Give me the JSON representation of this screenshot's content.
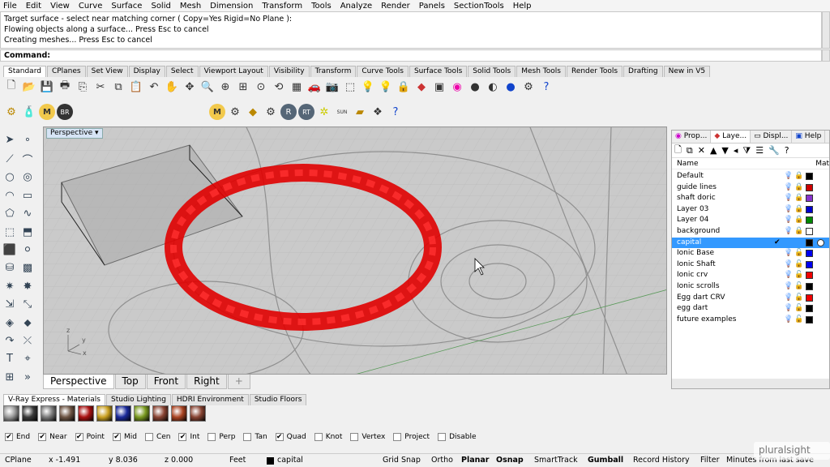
{
  "menu": [
    "File",
    "Edit",
    "View",
    "Curve",
    "Surface",
    "Solid",
    "Mesh",
    "Dimension",
    "Transform",
    "Tools",
    "Analyze",
    "Render",
    "Panels",
    "SectionTools",
    "Help"
  ],
  "history": [
    "Target surface - select near matching corner ( Copy=Yes  Rigid=No  Plane ):",
    "Flowing objects along a surface... Press Esc to cancel",
    "Creating meshes... Press Esc to cancel"
  ],
  "command_label": "Command:",
  "toolbar_tabs": [
    "Standard",
    "CPlanes",
    "Set View",
    "Display",
    "Select",
    "Viewport Layout",
    "Visibility",
    "Transform",
    "Curve Tools",
    "Surface Tools",
    "Solid Tools",
    "Mesh Tools",
    "Render Tools",
    "Drafting",
    "New in V5"
  ],
  "plugin_labels": {
    "m": "M",
    "br": "BR",
    "r": "R",
    "rt": "RT",
    "sun": "SUN"
  },
  "viewport": {
    "title": "Perspective",
    "axis_y": "y",
    "axis_z": "z",
    "axis_x": "x"
  },
  "viewport_tabs": [
    "Perspective",
    "Top",
    "Front",
    "Right"
  ],
  "viewport_add": "+",
  "panel": {
    "tabs": [
      "Prop...",
      "Laye...",
      "Displ...",
      "Help"
    ],
    "name_header": "Name",
    "mat_header": "Mat",
    "layers": [
      {
        "name": "Default",
        "color": "#000000",
        "locked": true
      },
      {
        "name": "guide lines",
        "color": "#cc0000",
        "locked": true
      },
      {
        "name": "shaft doric",
        "color": "#8833cc",
        "locked": true
      },
      {
        "name": "Layer 03",
        "color": "#0000cc",
        "locked": true
      },
      {
        "name": "Layer 04",
        "color": "#008800",
        "locked": true
      },
      {
        "name": "background",
        "color": "#ffffff",
        "locked": true
      },
      {
        "name": "capital",
        "color": "#000000",
        "locked": false,
        "selected": true
      },
      {
        "name": "Ionic Base",
        "color": "#0000ee",
        "locked": false
      },
      {
        "name": "Ionic Shaft",
        "color": "#0000ee",
        "locked": false
      },
      {
        "name": "Ionic crv",
        "color": "#ee0000",
        "locked": false
      },
      {
        "name": "Ionic scrolls",
        "color": "#000000",
        "locked": false
      },
      {
        "name": "Egg dart CRV",
        "color": "#ee0000",
        "locked": false
      },
      {
        "name": "egg dart",
        "color": "#000000",
        "locked": false
      },
      {
        "name": "future examples",
        "color": "#000000",
        "locked": false
      }
    ]
  },
  "lower_tabs": [
    "V-Ray Express - Materials",
    "Studio Lighting",
    "HDRI Environment",
    "Studio Floors"
  ],
  "materials": [
    "#9a9a9a",
    "#3a3a3a",
    "#7a7a7a",
    "#6e5544",
    "#aa1111",
    "#c9a020",
    "#1a2a9a",
    "#7a9a20",
    "#8a4433",
    "#aa4422",
    "#884433"
  ],
  "osnaps": [
    {
      "label": "End",
      "on": true
    },
    {
      "label": "Near",
      "on": true
    },
    {
      "label": "Point",
      "on": true
    },
    {
      "label": "Mid",
      "on": true
    },
    {
      "label": "Cen",
      "on": false
    },
    {
      "label": "Int",
      "on": true
    },
    {
      "label": "Perp",
      "on": false
    },
    {
      "label": "Tan",
      "on": false
    },
    {
      "label": "Quad",
      "on": true
    },
    {
      "label": "Knot",
      "on": false
    },
    {
      "label": "Vertex",
      "on": false
    },
    {
      "label": "Project",
      "on": false
    },
    {
      "label": "Disable",
      "on": false
    }
  ],
  "status": {
    "cplane": "CPlane",
    "x": "x -1.491",
    "y": "y 8.036",
    "z": "z 0.000",
    "units": "Feet",
    "layer": "capital",
    "grid_snap": "Grid Snap",
    "ortho": "Ortho",
    "planar": "Planar",
    "osnap": "Osnap",
    "smarttrack": "SmartTrack",
    "gumball": "Gumball",
    "record_history": "Record History",
    "filter": "Filter",
    "minutes": "Minutes from last save"
  },
  "watermark": "pluralsight"
}
